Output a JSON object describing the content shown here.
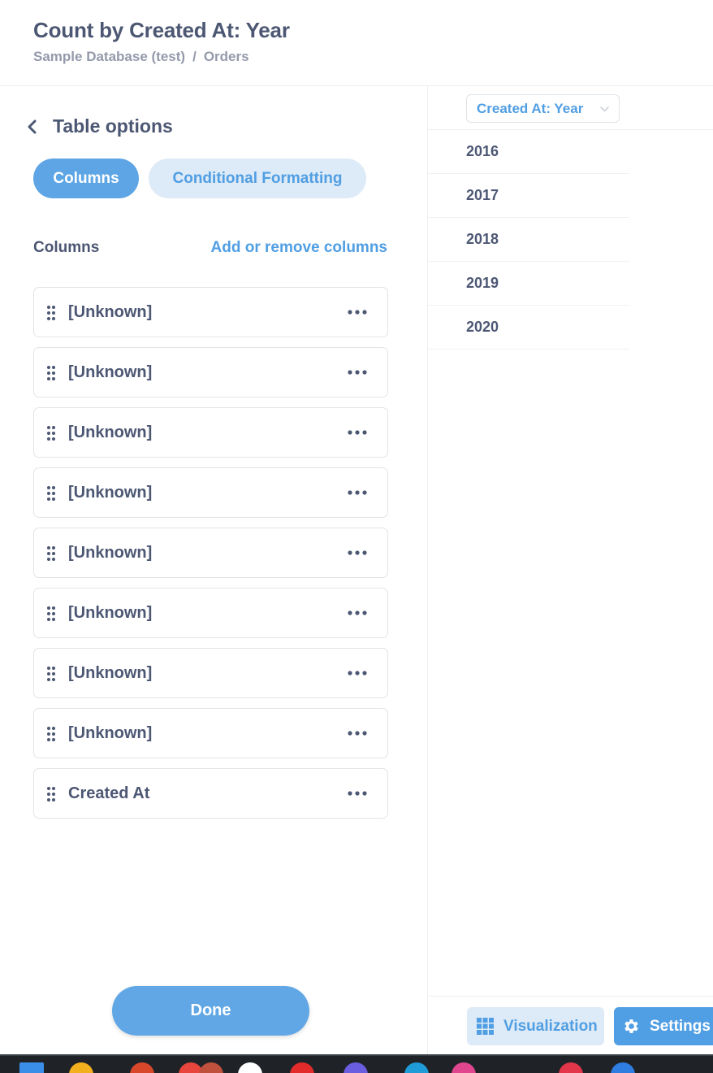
{
  "header": {
    "title": "Count by Created At: Year",
    "breadcrumb": {
      "database": "Sample Database (test)",
      "separator": "/",
      "table": "Orders"
    }
  },
  "sidebar": {
    "back_label": "Table options",
    "tabs": [
      {
        "label": "Columns",
        "active": true
      },
      {
        "label": "Conditional Formatting",
        "active": false
      }
    ],
    "columns_heading": "Columns",
    "add_remove_label": "Add or remove columns",
    "columns": [
      {
        "name": "[Unknown]"
      },
      {
        "name": "[Unknown]"
      },
      {
        "name": "[Unknown]"
      },
      {
        "name": "[Unknown]"
      },
      {
        "name": "[Unknown]"
      },
      {
        "name": "[Unknown]"
      },
      {
        "name": "[Unknown]"
      },
      {
        "name": "[Unknown]"
      },
      {
        "name": "Created At"
      }
    ],
    "done_label": "Done"
  },
  "table": {
    "column_header": "Created At: Year",
    "rows": [
      "2016",
      "2017",
      "2018",
      "2019",
      "2020"
    ]
  },
  "footer": {
    "visualization_label": "Visualization",
    "settings_label": "Settings"
  },
  "colors": {
    "brand": "#509ee3",
    "brand_light": "#ddeaf7",
    "text_dark": "#4c5773",
    "text_muted": "#949aab",
    "border": "#e1e4e8"
  },
  "taskbar": {
    "icons": [
      "windows-start-icon",
      "file-explorer-icon",
      "user-app-icon",
      "chrome-icon",
      "photo-app-icon",
      "white-app-icon",
      "red-app-icon",
      "messenger-icon",
      "edge-icon",
      "pink-app-icon",
      "red-app-icon-2",
      "blue-app-icon"
    ]
  }
}
